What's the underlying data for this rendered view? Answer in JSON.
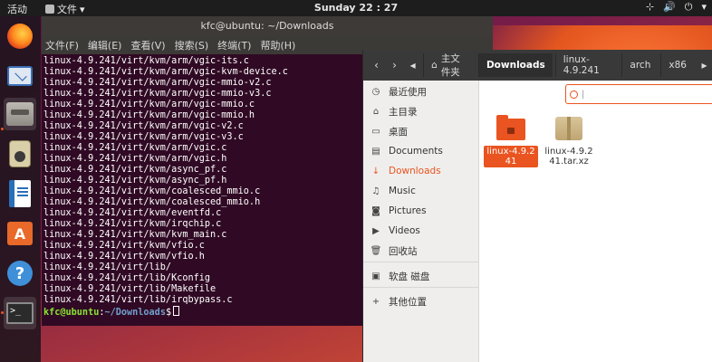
{
  "topbar": {
    "activities": "活动",
    "app_menu": "文件",
    "app_menu_arrow": "▾",
    "clock": "Sunday 22 : 27",
    "tray": [
      "⊹",
      "🔊",
      "⏻",
      "▾"
    ]
  },
  "dock": {
    "items": [
      {
        "name": "firefox-icon"
      },
      {
        "name": "thunderbird-icon"
      },
      {
        "name": "files-icon"
      },
      {
        "name": "rhythmbox-icon"
      },
      {
        "name": "writer-icon"
      },
      {
        "name": "software-icon",
        "glyph": "A"
      },
      {
        "name": "help-icon",
        "glyph": "?"
      },
      {
        "name": "terminal-icon",
        "glyph": ">_"
      }
    ]
  },
  "terminal": {
    "title": "kfc@ubuntu: ~/Downloads",
    "menu": [
      "文件(F)",
      "编辑(E)",
      "查看(V)",
      "搜索(S)",
      "终端(T)",
      "帮助(H)"
    ],
    "lines": [
      "linux-4.9.241/virt/kvm/arm/vgic-its.c",
      "linux-4.9.241/virt/kvm/arm/vgic-kvm-device.c",
      "linux-4.9.241/virt/kvm/arm/vgic-mmio-v2.c",
      "linux-4.9.241/virt/kvm/arm/vgic-mmio-v3.c",
      "linux-4.9.241/virt/kvm/arm/vgic-mmio.c",
      "linux-4.9.241/virt/kvm/arm/vgic-mmio.h",
      "linux-4.9.241/virt/kvm/arm/vgic-v2.c",
      "linux-4.9.241/virt/kvm/arm/vgic-v3.c",
      "linux-4.9.241/virt/kvm/arm/vgic.c",
      "linux-4.9.241/virt/kvm/arm/vgic.h",
      "linux-4.9.241/virt/kvm/async_pf.c",
      "linux-4.9.241/virt/kvm/async_pf.h",
      "linux-4.9.241/virt/kvm/coalesced_mmio.c",
      "linux-4.9.241/virt/kvm/coalesced_mmio.h",
      "linux-4.9.241/virt/kvm/eventfd.c",
      "linux-4.9.241/virt/kvm/irqchip.c",
      "linux-4.9.241/virt/kvm/kvm_main.c",
      "linux-4.9.241/virt/kvm/vfio.c",
      "linux-4.9.241/virt/kvm/vfio.h",
      "linux-4.9.241/virt/lib/",
      "linux-4.9.241/virt/lib/Kconfig",
      "linux-4.9.241/virt/lib/Makefile",
      "linux-4.9.241/virt/lib/irqbypass.c"
    ],
    "prompt_user": "kfc@ubuntu",
    "prompt_sep": ":",
    "prompt_path": "~/Downloads",
    "prompt_symbol": "$"
  },
  "files": {
    "nav": {
      "back": "‹",
      "forward": "›",
      "left_scroll": "◂",
      "right_scroll": "▸"
    },
    "breadcrumbs": [
      {
        "label": "主文件夹",
        "icon": "⌂"
      },
      {
        "label": "Downloads",
        "current": true
      },
      {
        "label": "linux-4.9.241"
      },
      {
        "label": "arch"
      },
      {
        "label": "x86"
      }
    ],
    "sidebar": [
      {
        "label": "最近使用",
        "icon": "◷",
        "name": "recent"
      },
      {
        "label": "主目录",
        "icon": "⌂",
        "name": "home"
      },
      {
        "label": "桌面",
        "icon": "▭",
        "name": "desktop"
      },
      {
        "label": "Documents",
        "icon": "▤",
        "name": "documents"
      },
      {
        "label": "Downloads",
        "icon": "↓",
        "name": "downloads",
        "selected": true
      },
      {
        "label": "Music",
        "icon": "♫",
        "name": "music"
      },
      {
        "label": "Pictures",
        "icon": "◙",
        "name": "pictures"
      },
      {
        "label": "Videos",
        "icon": "▶",
        "name": "videos"
      },
      {
        "label": "回收站",
        "icon": "🗑",
        "name": "trash"
      },
      {
        "label": "软盘 磁盘",
        "icon": "▣",
        "name": "floppy"
      },
      {
        "label": "其他位置",
        "icon": "+",
        "name": "other-locations"
      }
    ],
    "search": {
      "value": "|"
    },
    "items": [
      {
        "label": "linux-4.9.241",
        "type": "folder",
        "selected": true
      },
      {
        "label": "linux-4.9.241.tar.xz",
        "type": "archive"
      }
    ],
    "colors": {
      "accent": "#e95420"
    }
  }
}
